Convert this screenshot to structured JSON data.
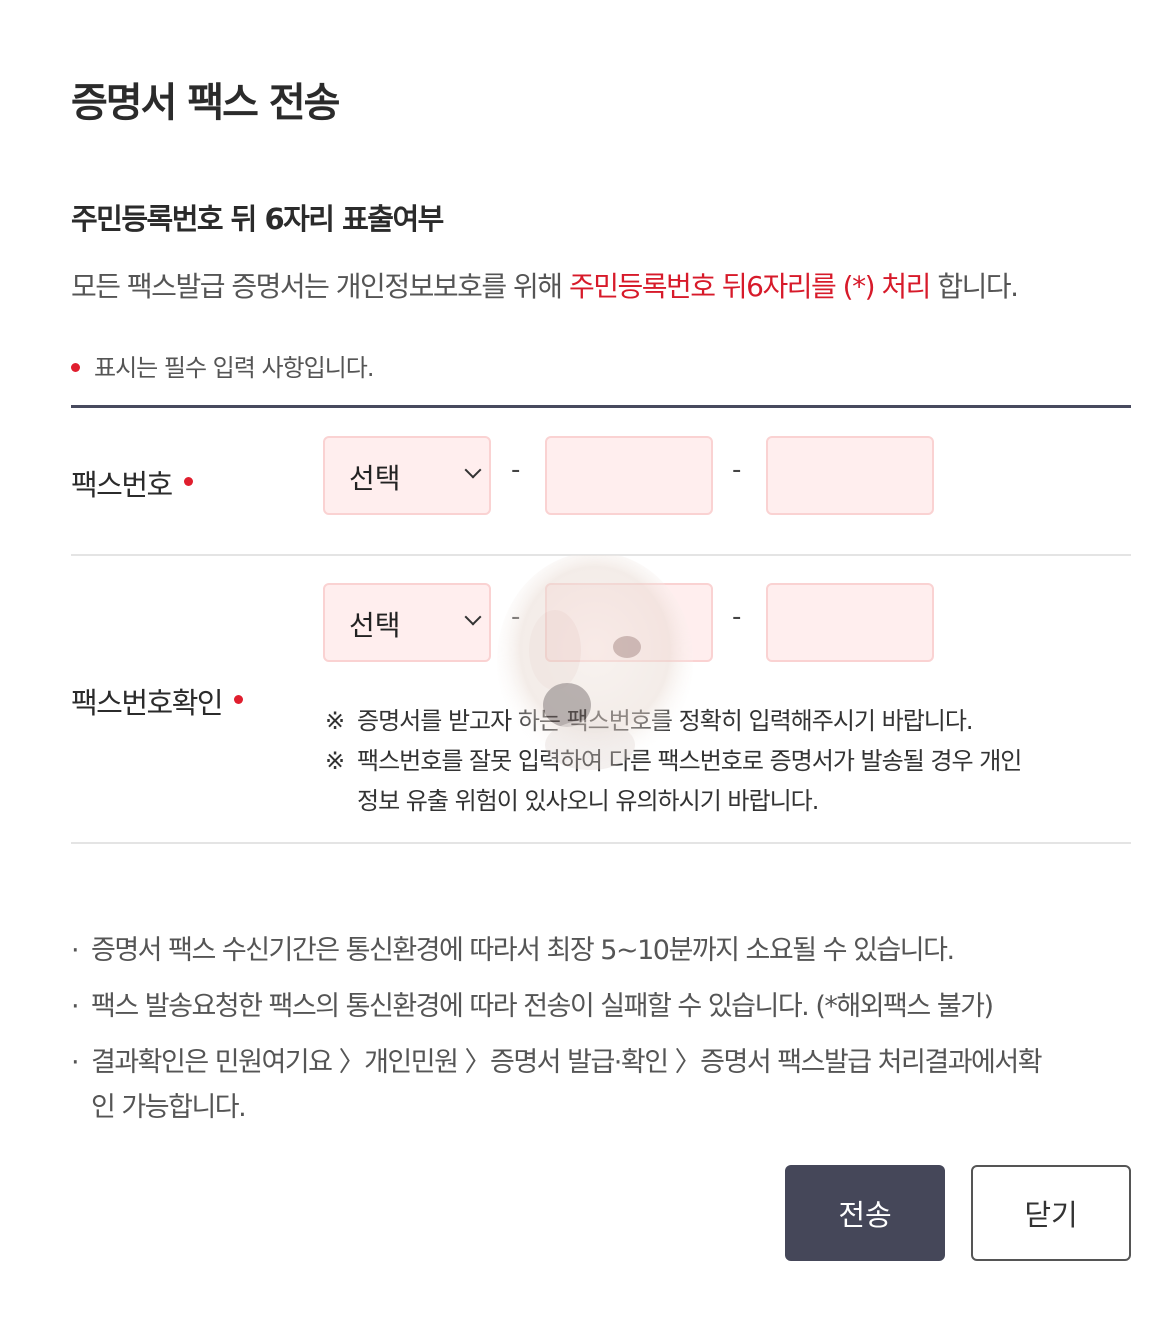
{
  "dialog": {
    "title": "증명서 팩스 전송"
  },
  "masking": {
    "heading": "주민등록번호 뒤 6자리 표출여부",
    "desc_prefix": "모든 팩스발급 증명서는 개인정보보호를 위해 ",
    "desc_highlight": "주민등록번호 뒤6자리를 (*) 처리",
    "desc_suffix": " 합니다."
  },
  "required_note": "표시는 필수 입력 사항입니다.",
  "fax_number": {
    "label": "팩스번호",
    "select_value": "선택",
    "separator": "-",
    "part2_value": "",
    "part3_value": ""
  },
  "fax_confirm": {
    "label": "팩스번호확인",
    "select_value": "선택",
    "separator": "-",
    "part2_value": "",
    "part3_value": "",
    "notice_mark": "※",
    "notice_1": "증명서를 받고자 하는 팩스번호를 정확히 입력해주시기 바랍니다.",
    "notice_2_line1": "팩스번호를 잘못 입력하여 다른 팩스번호로 증명서가 발송될 경우 개인",
    "notice_2_line2": "정보 유출 위험이 있사오니 유의하시기 바랍니다."
  },
  "info": {
    "bullet": "·",
    "item_1": "증명서 팩스 수신기간은 통신환경에 따라서 최장 5~10분까지 소요될 수 있습니다.",
    "item_2": "팩스 발송요청한 팩스의 통신환경에 따라 전송이 실패할 수 있습니다. (*해외팩스 불가)",
    "item_3_line1": "결과확인은 민원여기요 〉개인민원 〉증명서 발급·확인 〉증명서 팩스발급 처리결과에서확",
    "item_3_line2": "인 가능합니다."
  },
  "buttons": {
    "send": "전송",
    "close": "닫기"
  },
  "colors": {
    "accent_red": "#d71a2a",
    "input_bg": "#ffeeee",
    "primary_button": "#454759"
  }
}
